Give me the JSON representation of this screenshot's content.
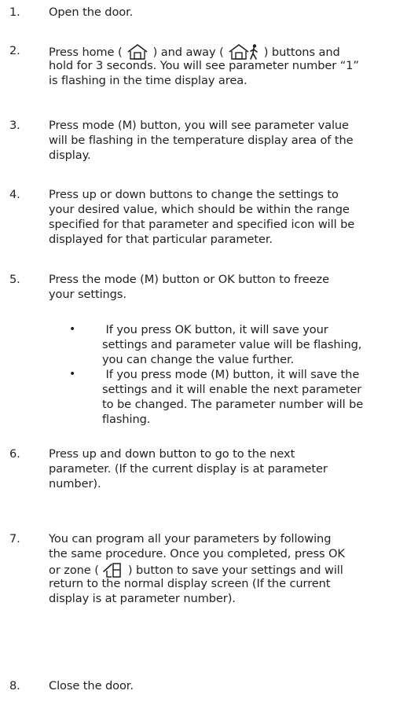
{
  "steps": [
    {
      "num": "1.",
      "lines": [
        "Open the door."
      ]
    },
    {
      "num": "2.",
      "l1_a": "Press home (",
      "l1_b": ") and away (",
      "l1_c": ") buttons and",
      "lines_rest": [
        "hold for 3 seconds. You will see parameter number “1”",
        "is flashing in the time display area."
      ],
      "icons": [
        "home-icon",
        "away-icon"
      ]
    },
    {
      "num": "3.",
      "lines": [
        "Press mode (M) button, you will see parameter value",
        "will be flashing in the temperature display area of the",
        "display."
      ]
    },
    {
      "num": "4.",
      "lines": [
        "Press up or down buttons to change the settings to",
        "your desired value, which should be within the range",
        "specified for that parameter and specified icon will be",
        "displayed for that particular parameter."
      ]
    },
    {
      "num": "5.",
      "lines": [
        "Press the mode (M) button or OK button to freeze",
        "your settings."
      ],
      "bullets": [
        {
          "symbol": "•",
          "lines": [
            " If you press OK button, it will save your",
            "settings and parameter value will be flashing,",
            "you can change the value further."
          ]
        },
        {
          "symbol": "•",
          "lines": [
            " If you press mode (M) button, it will save the",
            "settings and it will enable the next parameter",
            "to be changed. The parameter number will be",
            "flashing."
          ]
        }
      ]
    },
    {
      "num": "6.",
      "lines": [
        "Press up and down button to go to the next",
        "parameter. (If the current display is at parameter",
        "number)."
      ]
    },
    {
      "num": "7.",
      "lines_a": [
        "You can program all your parameters by following",
        "the same procedure. Once you completed, press OK"
      ],
      "l3_a": "or zone (",
      "l3_b": ") button to save your settings and will",
      "lines_rest": [
        "return to the normal display screen (If the current",
        "display is at parameter number)."
      ],
      "icons": [
        "zone-icon"
      ]
    },
    {
      "num": "8.",
      "lines": [
        "Close the door."
      ]
    }
  ]
}
